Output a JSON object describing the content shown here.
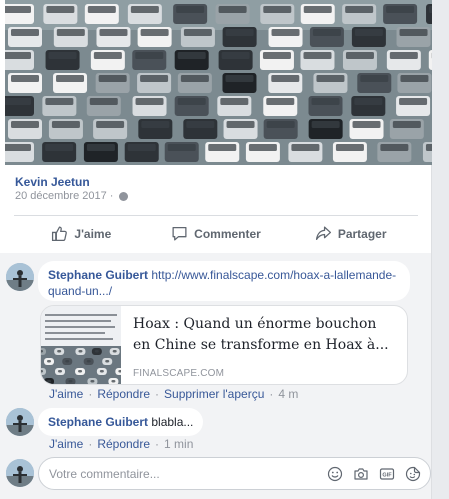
{
  "post": {
    "image_alt": "traffic jam photo",
    "author": "Kevin Jeetun",
    "date": "20 décembre 2017 ·",
    "actions": {
      "like": "J'aime",
      "comment": "Commenter",
      "share": "Partager"
    }
  },
  "comments": [
    {
      "author": "Stephane Guibert",
      "text": "http://www.finalscape.com/hoax-a-lallemande-quand-un.../",
      "preview": {
        "title": "Hoax : Quand un énorme bouchon en Chine se transforme en Hoax à...",
        "domain": "FINALSCAPE.COM"
      },
      "meta": {
        "like": "J'aime",
        "reply": "Répondre",
        "remove": "Supprimer l'aperçu",
        "time": "4 m"
      }
    },
    {
      "author": "Stephane Guibert",
      "text": "blabla...",
      "meta": {
        "like": "J'aime",
        "reply": "Répondre",
        "time": "1 min"
      }
    }
  ],
  "composer": {
    "placeholder": "Votre commentaire..."
  },
  "icons": [
    "like-icon",
    "comment-icon",
    "share-icon",
    "globe-icon",
    "emoji-icon",
    "camera-icon",
    "gif-icon",
    "sticker-icon"
  ],
  "colors": {
    "link": "#365899",
    "muted": "#90949c",
    "action": "#606770",
    "background": "#e9ebee"
  }
}
